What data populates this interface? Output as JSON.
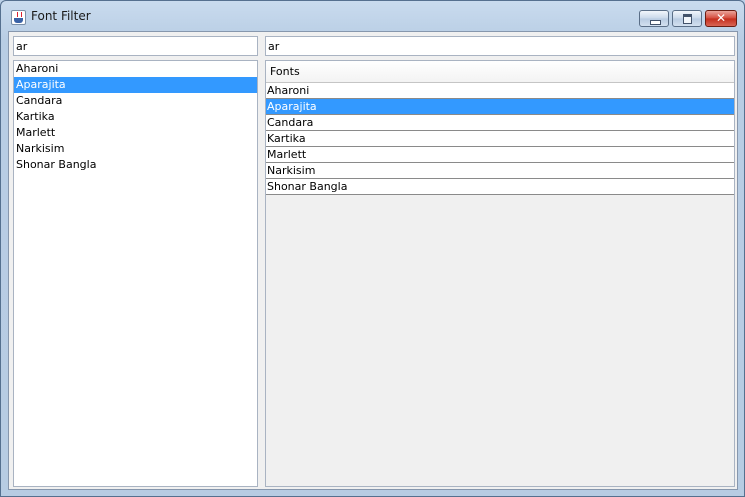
{
  "window": {
    "title": "Font Filter"
  },
  "left": {
    "search_value": "ar",
    "items": [
      {
        "label": "Aharoni",
        "selected": false
      },
      {
        "label": "Aparajita",
        "selected": true
      },
      {
        "label": "Candara",
        "selected": false
      },
      {
        "label": "Kartika",
        "selected": false
      },
      {
        "label": "Marlett",
        "selected": false
      },
      {
        "label": "Narkisim",
        "selected": false
      },
      {
        "label": "Shonar Bangla",
        "selected": false
      }
    ]
  },
  "right": {
    "search_value": "ar",
    "column_header": "Fonts",
    "rows": [
      {
        "label": "Aharoni",
        "selected": false
      },
      {
        "label": "Aparajita",
        "selected": true
      },
      {
        "label": "Candara",
        "selected": false
      },
      {
        "label": "Kartika",
        "selected": false
      },
      {
        "label": "Marlett",
        "selected": false
      },
      {
        "label": "Narkisim",
        "selected": false
      },
      {
        "label": "Shonar Bangla",
        "selected": false
      }
    ]
  },
  "icons": {
    "app": "java-cup-icon",
    "minimize": "minimize-icon",
    "maximize": "maximize-icon",
    "close": "close-icon"
  },
  "colors": {
    "selection": "#3399ff",
    "title_bar": "#c9dbee",
    "close_button": "#c42d1b"
  }
}
